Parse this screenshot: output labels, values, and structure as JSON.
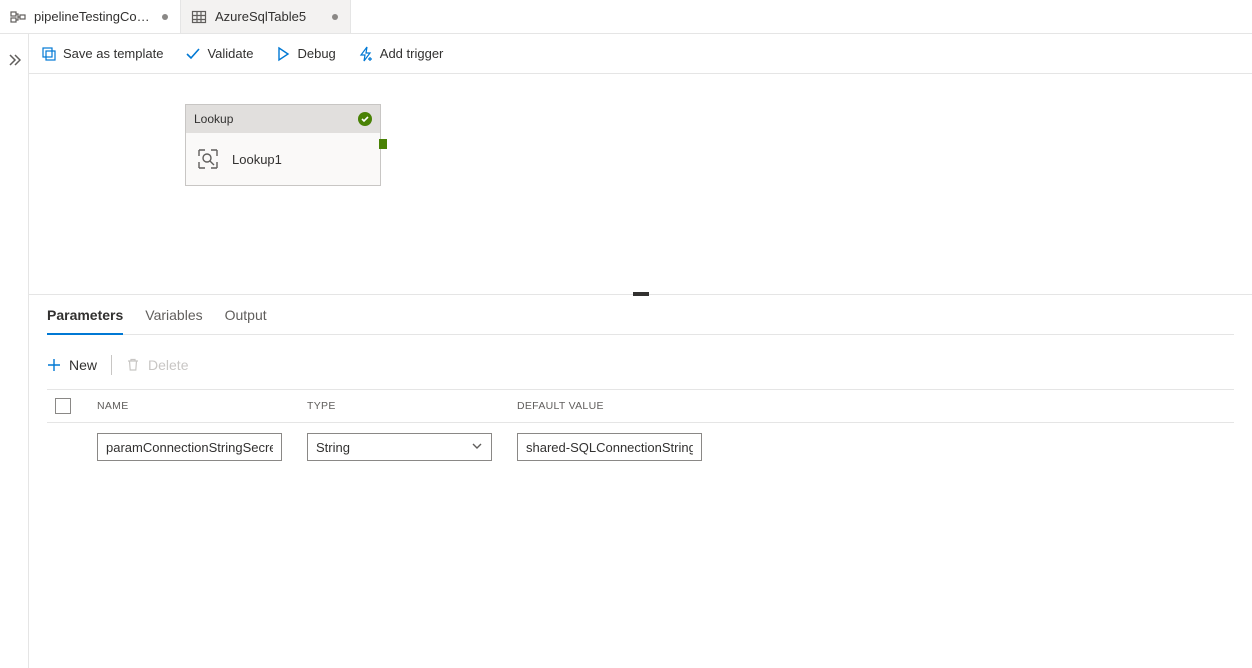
{
  "tabs": [
    {
      "icon": "pipeline",
      "label": "pipelineTestingCom…",
      "dirty": true,
      "active": true
    },
    {
      "icon": "table",
      "label": "AzureSqlTable5",
      "dirty": true,
      "active": false
    }
  ],
  "toolbar": {
    "save_as_template": "Save as template",
    "validate": "Validate",
    "debug": "Debug",
    "add_trigger": "Add trigger"
  },
  "activity": {
    "type_label": "Lookup",
    "name": "Lookup1",
    "status": "success"
  },
  "panel_tabs": {
    "parameters": "Parameters",
    "variables": "Variables",
    "output": "Output"
  },
  "param_toolbar": {
    "new_label": "New",
    "delete_label": "Delete"
  },
  "param_headers": {
    "name": "NAME",
    "type": "TYPE",
    "default_value": "DEFAULT VALUE"
  },
  "parameters": [
    {
      "name": "paramConnectionStringSecret",
      "type": "String",
      "default_value": "shared-SQLConnectionString-k"
    }
  ]
}
